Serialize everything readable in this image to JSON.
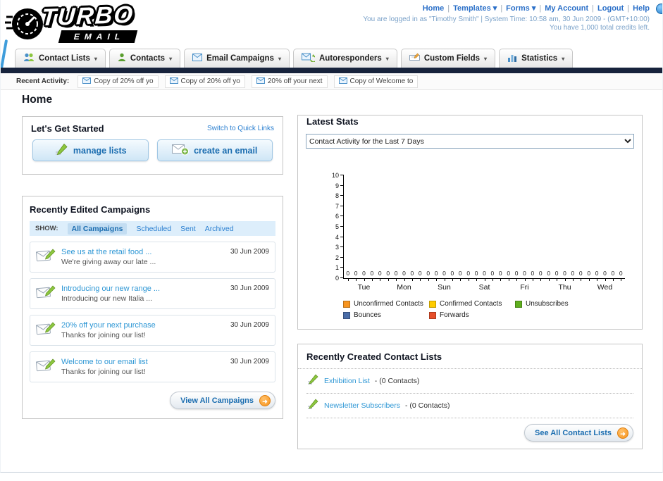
{
  "icons": {
    "caret": "▾",
    "arrow": "➜"
  },
  "header": {
    "logo_title": "TURBO",
    "logo_subtitle": "EMAIL",
    "separator": "|",
    "nav_links": [
      "Home",
      "Templates ▾",
      "Forms ▾",
      "My Account",
      "Logout",
      "Help"
    ],
    "login_info": "You are logged in as \"Timothy Smith\" | System Time: 10:58 am, 30 Jun 2009 - (GMT+10:00)",
    "credits_info": "You have 1,000 total credits left."
  },
  "main_nav": {
    "tabs": [
      {
        "label": "Contact Lists"
      },
      {
        "label": "Contacts"
      },
      {
        "label": "Email Campaigns"
      },
      {
        "label": "Autoresponders"
      },
      {
        "label": "Custom Fields"
      },
      {
        "label": "Statistics"
      }
    ]
  },
  "recent_activity": {
    "label": "Recent Activity:",
    "items": [
      "Copy of 20% off yo",
      "Copy of 20% off yo",
      "20% off your next",
      "Copy of Welcome to"
    ]
  },
  "page": {
    "title": "Home"
  },
  "get_started": {
    "title": "Let's Get Started",
    "switch_link": "Switch to Quick Links",
    "manage_lists_label": "manage lists",
    "create_email_label": "create an email"
  },
  "campaigns": {
    "title": "Recently Edited Campaigns",
    "show_label": "SHOW:",
    "filters": [
      "All Campaigns",
      "Scheduled",
      "Sent",
      "Archived"
    ],
    "items": [
      {
        "title": "See us at the retail food ...",
        "subtitle": "We're giving away our late ...",
        "date": "30 Jun 2009"
      },
      {
        "title": "Introducing our new range ...",
        "subtitle": "Introducing our new Italia ...",
        "date": "30 Jun 2009"
      },
      {
        "title": "20% off your next purchase",
        "subtitle": "Thanks for joining our list!",
        "date": "30 Jun 2009"
      },
      {
        "title": "Welcome to our email list",
        "subtitle": "Thanks for joining our list!",
        "date": "30 Jun 2009"
      }
    ],
    "view_all_label": "View All Campaigns"
  },
  "stats": {
    "title": "Latest Stats",
    "dropdown_value": "Contact Activity for the Last 7 Days",
    "chart_data": {
      "type": "bar",
      "title": "Contact Activity for the Last 7 Days",
      "categories": [
        "Tue",
        "Mon",
        "Sun",
        "Sat",
        "Fri",
        "Thu",
        "Wed"
      ],
      "series": [
        {
          "name": "Unconfirmed Contacts",
          "color": "#f7941e",
          "values": [
            0,
            0,
            0,
            0,
            0,
            0,
            0
          ]
        },
        {
          "name": "Confirmed Contacts",
          "color": "#ffcc00",
          "values": [
            0,
            0,
            0,
            0,
            0,
            0,
            0
          ]
        },
        {
          "name": "Unsubscribes",
          "color": "#5faf1e",
          "values": [
            0,
            0,
            0,
            0,
            0,
            0,
            0
          ]
        },
        {
          "name": "Bounces",
          "color": "#4a6da8",
          "values": [
            0,
            0,
            0,
            0,
            0,
            0,
            0
          ]
        },
        {
          "name": "Forwards",
          "color": "#e64f2a",
          "values": [
            0,
            0,
            0,
            0,
            0,
            0,
            0
          ]
        }
      ],
      "xlabel": "",
      "ylabel": "",
      "ylim": [
        0,
        10
      ],
      "ytick_step": 1,
      "grid": false,
      "legend_position": "bottom"
    }
  },
  "contact_lists": {
    "title": "Recently Created Contact Lists",
    "items": [
      {
        "name": "Exhibition List",
        "detail": "- (0 Contacts)"
      },
      {
        "name": "Newsletter Subscribers",
        "detail": "- (0 Contacts)"
      }
    ],
    "see_all_label": "See All Contact Lists"
  }
}
